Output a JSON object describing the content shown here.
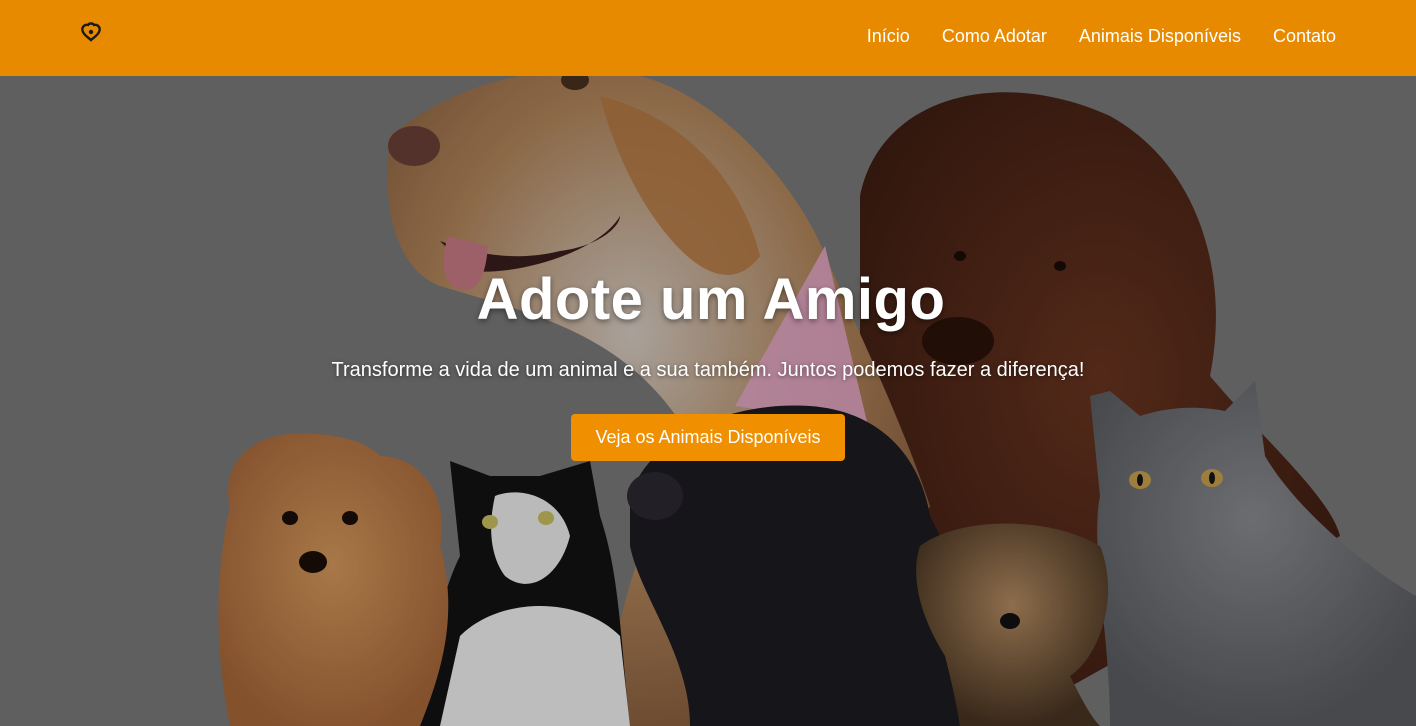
{
  "nav": {
    "logo_icon": "paw-heart-icon",
    "links": [
      {
        "label": "Início"
      },
      {
        "label": "Como Adotar"
      },
      {
        "label": "Animais Disponíveis"
      },
      {
        "label": "Contato"
      }
    ]
  },
  "hero": {
    "title": "Adote um Amigo",
    "subtitle": "Transforme a vida de um animal e a sua também. Juntos podemos fazer a diferença!",
    "cta_label": "Veja os Animais Disponíveis",
    "background": "group photo of dogs, cats and a pig with a party hat"
  },
  "colors": {
    "navbar": "#e88a00",
    "cta": "#f08f00",
    "text": "#ffffff"
  }
}
